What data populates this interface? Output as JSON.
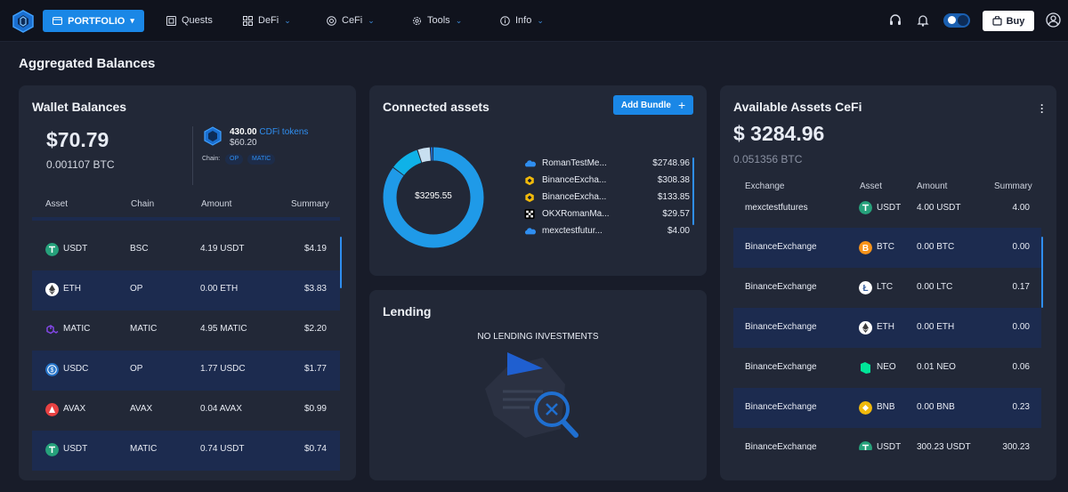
{
  "nav": {
    "portfolio": "PORTFOLIO",
    "quests": "Quests",
    "defi": "DeFi",
    "cefi": "CeFi",
    "tools": "Tools",
    "info": "Info",
    "buy": "Buy"
  },
  "page_title": "Aggregated Balances",
  "wallet": {
    "title": "Wallet Balances",
    "usd": "$70.79",
    "btc": "0.001107 BTC",
    "cdfi_amount": "430.00",
    "cdfi_token": "CDFi tokens",
    "cdfi_usd": "$60.20",
    "chain_label": "Chain:",
    "chains": [
      "OP",
      "MATIC"
    ],
    "columns": [
      "Asset",
      "Chain",
      "Amount",
      "Summary"
    ],
    "rows": [
      {
        "asset": "USDT",
        "chain": "BSC",
        "amount": "4.19 USDT",
        "summary": "$4.19",
        "icon": "tether-icon",
        "color": "#26a17b"
      },
      {
        "asset": "ETH",
        "chain": "OP",
        "amount": "0.00 ETH",
        "summary": "$3.83",
        "icon": "ethereum-icon",
        "color": "#ffffff"
      },
      {
        "asset": "MATIC",
        "chain": "MATIC",
        "amount": "4.95 MATIC",
        "summary": "$2.20",
        "icon": "polygon-icon",
        "color": "#8247e5"
      },
      {
        "asset": "USDC",
        "chain": "OP",
        "amount": "1.77 USDC",
        "summary": "$1.77",
        "icon": "usdc-icon",
        "color": "#2775ca"
      },
      {
        "asset": "AVAX",
        "chain": "AVAX",
        "amount": "0.04 AVAX",
        "summary": "$0.99",
        "icon": "avax-icon",
        "color": "#e84142"
      },
      {
        "asset": "USDT",
        "chain": "MATIC",
        "amount": "0.74 USDT",
        "summary": "$0.74",
        "icon": "tether-icon",
        "color": "#26a17b"
      }
    ]
  },
  "connected": {
    "title": "Connected assets",
    "add_bundle": "Add Bundle",
    "total": "$3295.55",
    "assets": [
      {
        "name": "RomanTestMe...",
        "value": "$2748.96",
        "icon": "cloud-icon",
        "color": "#2f8ef0"
      },
      {
        "name": "BinanceExcha...",
        "value": "$308.38",
        "icon": "binance-icon",
        "color": "#f0b90b"
      },
      {
        "name": "BinanceExcha...",
        "value": "$133.85",
        "icon": "binance-icon",
        "color": "#f0b90b"
      },
      {
        "name": "OKXRomanMa...",
        "value": "$29.57",
        "icon": "okx-icon",
        "color": "#ffffff"
      },
      {
        "name": "mexctestfutur...",
        "value": "$4.00",
        "icon": "cloud-icon",
        "color": "#2f8ef0"
      }
    ],
    "donut_values": [
      2748.96,
      308.38,
      133.85,
      29.57,
      4.0
    ],
    "donut_colors": [
      "#1f9ae8",
      "#0fb2e8",
      "#c8dff0",
      "#1f6fd0",
      "#2f8ef0"
    ]
  },
  "lending": {
    "title": "Lending",
    "empty": "NO LENDING INVESTMENTS"
  },
  "cefi": {
    "title": "Available Assets CeFi",
    "usd": "$ 3284.96",
    "btc": "0.051356 BTC",
    "columns": [
      "Exchange",
      "Asset",
      "Amount",
      "Summary"
    ],
    "top_row": {
      "exchange": "mexctestfutures",
      "asset": "USDT",
      "amount": "4.00 USDT",
      "summary": "4.00"
    },
    "rows": [
      {
        "exchange": "BinanceExchange",
        "asset": "BTC",
        "amount": "0.00 BTC",
        "summary": "0.00",
        "icon": "bitcoin-icon",
        "color": "#f7931a"
      },
      {
        "exchange": "BinanceExchange",
        "asset": "LTC",
        "amount": "0.00 LTC",
        "summary": "0.17",
        "icon": "litecoin-icon",
        "color": "#345d9d"
      },
      {
        "exchange": "BinanceExchange",
        "asset": "ETH",
        "amount": "0.00 ETH",
        "summary": "0.00",
        "icon": "ethereum-icon",
        "color": "#ffffff"
      },
      {
        "exchange": "BinanceExchange",
        "asset": "NEO",
        "amount": "0.01 NEO",
        "summary": "0.06",
        "icon": "neo-icon",
        "color": "#00e599"
      },
      {
        "exchange": "BinanceExchange",
        "asset": "BNB",
        "amount": "0.00 BNB",
        "summary": "0.23",
        "icon": "bnb-icon",
        "color": "#f0b90b"
      },
      {
        "exchange": "BinanceExchange",
        "asset": "USDT",
        "amount": "300.23 USDT",
        "summary": "300.23",
        "icon": "tether-icon",
        "color": "#26a17b"
      }
    ]
  }
}
